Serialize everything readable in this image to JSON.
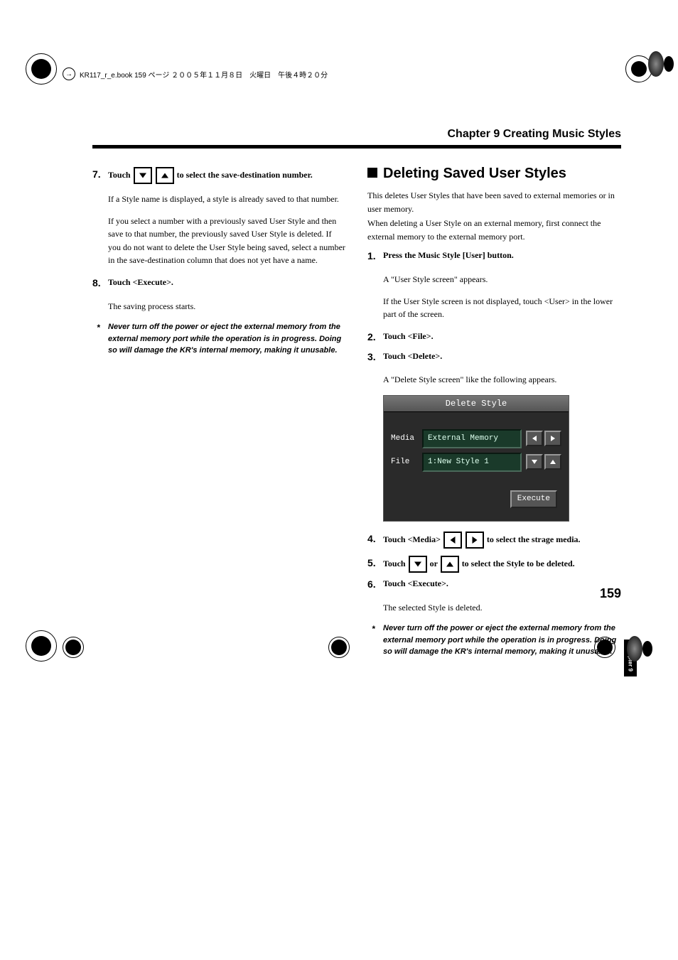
{
  "header_mark": "KR117_r_e.book  159 ページ  ２００５年１１月８日　火曜日　午後４時２０分",
  "chapter_title": "Chapter 9 Creating Music Styles",
  "side_tab": "Chapter 9",
  "page_number": "159",
  "left": {
    "step7": {
      "num": "7.",
      "lead_a": "Touch ",
      "lead_b": " to select the save-destination number.",
      "p1": "If a Style name is displayed, a style is already saved to that number.",
      "p2": "If you select a number with a previously saved User Style and then save to that number, the previously saved User Style is deleted. If you do not want to delete the User Style being saved, select a number in the save-destination column that does not yet have a name."
    },
    "step8": {
      "num": "8.",
      "lead": "Touch <Execute>.",
      "p1": "The saving process starts."
    },
    "note": "Never turn off the power or eject the external memory from the external memory port while the operation is in progress. Doing so will damage the KR's internal memory, making it unusable."
  },
  "right": {
    "heading": "Deleting Saved User Styles",
    "intro1": "This deletes User Styles that have been saved to external memories or in user memory.",
    "intro2": "When deleting a User Style on an external memory, first connect the external memory to the external memory port.",
    "step1": {
      "num": "1.",
      "lead": "Press the Music Style [User] button.",
      "p1": "A \"User Style screen\" appears.",
      "p2": "If the User Style screen is not displayed, touch <User> in the lower part of the screen."
    },
    "step2": {
      "num": "2.",
      "lead": "Touch <File>."
    },
    "step3": {
      "num": "3.",
      "lead": "Touch <Delete>.",
      "p1": "A \"Delete Style screen\" like the following appears."
    },
    "screenshot": {
      "title": "Delete Style",
      "media_label": "Media",
      "media_value": "External Memory",
      "file_label": "File",
      "file_value": "1:New Style 1",
      "execute": "Execute"
    },
    "step4": {
      "num": "4.",
      "lead_a": "Touch <Media> ",
      "lead_b": " to select the strage media."
    },
    "step5": {
      "num": "5.",
      "lead_a": "Touch ",
      "lead_mid": " or ",
      "lead_b": " to select the Style to be deleted."
    },
    "step6": {
      "num": "6.",
      "lead": "Touch <Execute>.",
      "p1": "The selected Style is deleted."
    },
    "note": "Never turn off the power or eject the external memory from the external memory port while the operation is in progress. Doing so will damage the KR's internal memory, making it unusable."
  }
}
